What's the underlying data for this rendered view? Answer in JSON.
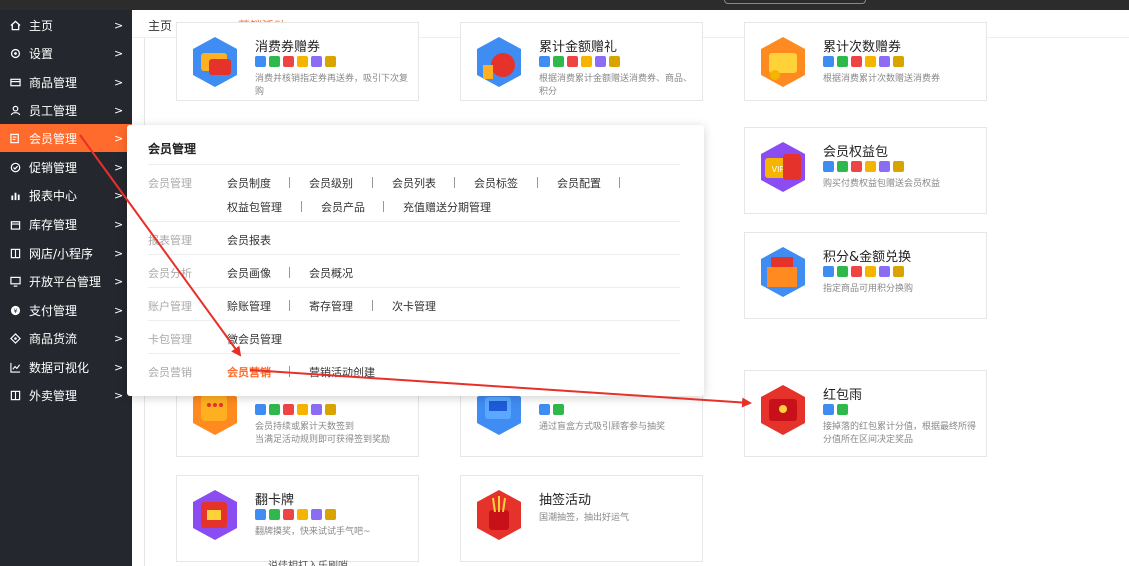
{
  "sidebar": {
    "items": [
      {
        "label": "主页",
        "icon": "home-icon"
      },
      {
        "label": "设置",
        "icon": "gear-icon"
      },
      {
        "label": "商品管理",
        "icon": "card-icon"
      },
      {
        "label": "员工管理",
        "icon": "user-icon"
      },
      {
        "label": "会员管理",
        "icon": "member-icon"
      },
      {
        "label": "促销管理",
        "icon": "check-circle-icon"
      },
      {
        "label": "报表中心",
        "icon": "bar-chart-icon"
      },
      {
        "label": "库存管理",
        "icon": "box-icon"
      },
      {
        "label": "网店/小程序",
        "icon": "store-icon"
      },
      {
        "label": "开放平台管理",
        "icon": "monitor-icon"
      },
      {
        "label": "支付管理",
        "icon": "pay-icon"
      },
      {
        "label": "商品货流",
        "icon": "flow-icon"
      },
      {
        "label": "数据可视化",
        "icon": "line-chart-icon"
      },
      {
        "label": "外卖管理",
        "icon": "takeout-icon"
      }
    ]
  },
  "tabs": {
    "home": "主页",
    "active": "营销活动"
  },
  "cards": [
    {
      "title": "消费券赠券",
      "desc": "消费并核销指定券再送券，吸引下次复购",
      "badges": 6
    },
    {
      "title": "累计金额赠礼",
      "desc": "根据消费累计金额赠送消费券、商品、积分",
      "badges": 6
    },
    {
      "title": "累计次数赠券",
      "desc": "根据消费累计次数赠送消费券",
      "badges": 6
    },
    {
      "title": "会员权益包",
      "desc": "购买付费权益包赠送会员权益",
      "badges": 6
    },
    {
      "title": "积分&金额兑换",
      "desc": "指定商品可用积分换购",
      "badges": 6
    },
    {
      "title": "",
      "desc": "会员持续或累计天数签到\n当满足活动规则即可获得签到奖励",
      "badges": 6
    },
    {
      "title": "",
      "desc": "通过盲盒方式吸引顾客参与抽奖",
      "badges": 2
    },
    {
      "title": "红包雨",
      "desc": "接掉落的红包累计分值，根据最终所得分值所在区间决定奖品",
      "badges": 2
    },
    {
      "title": "翻卡牌",
      "desc": "翻牌摸奖，快来试试手气吧~",
      "badges": 6
    },
    {
      "title": "抽签活动",
      "desc": "国潮抽签，抽出好运气",
      "badges": 0
    }
  ],
  "dropdown": {
    "title": "会员管理",
    "rows": [
      {
        "cat": "会员管理",
        "links": [
          "会员制度",
          "会员级别",
          "会员列表",
          "会员标签",
          "会员配置",
          "权益包管理",
          "会员产品",
          "充值赠送分期管理"
        ]
      },
      {
        "cat": "报表管理",
        "links": [
          "会员报表"
        ]
      },
      {
        "cat": "会员分析",
        "links": [
          "会员画像",
          "会员概况"
        ]
      },
      {
        "cat": "账户管理",
        "links": [
          "赊账管理",
          "寄存管理",
          "次卡管理"
        ]
      },
      {
        "cat": "卡包管理",
        "links": [
          "微会员管理"
        ]
      },
      {
        "cat": "会员营销",
        "links": [
          "会员营销",
          "营销活动创建"
        ]
      }
    ]
  },
  "bottom_text": "说佳相打入乐刷哨",
  "colors": {
    "accent": "#ff6b2c",
    "sidebar_bg": "#24272d",
    "arrow": "#e8302a"
  }
}
